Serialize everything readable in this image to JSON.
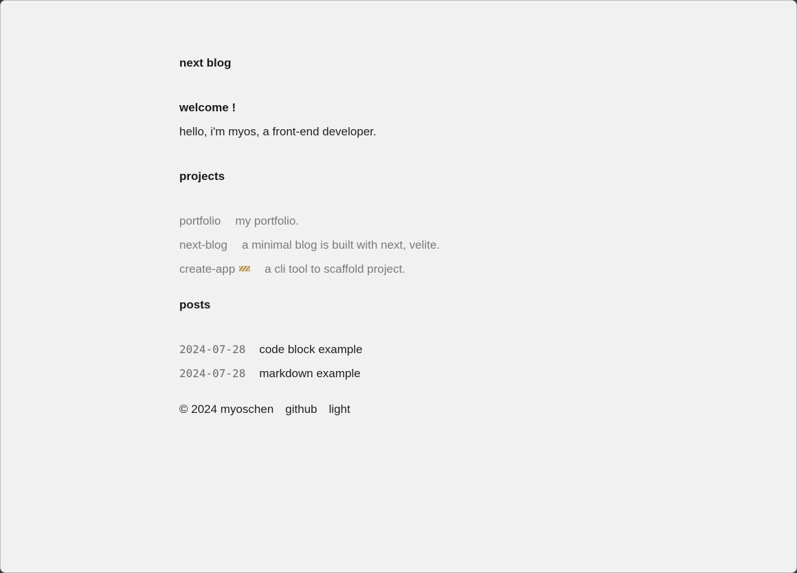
{
  "header": {
    "site_title": "next blog"
  },
  "welcome": {
    "title": "welcome !",
    "intro": "hello, i'm myos, a front-end developer."
  },
  "projects": {
    "title": "projects",
    "items": [
      {
        "name": "portfolio",
        "description": "my portfolio.",
        "wip": false
      },
      {
        "name": "next-blog",
        "description": "a minimal blog is built with next, velite.",
        "wip": false
      },
      {
        "name": "create-app",
        "description": "a cli tool to scaffold project.",
        "wip": true,
        "badge_icon": "work-in-progress-icon"
      }
    ]
  },
  "posts": {
    "title": "posts",
    "items": [
      {
        "date": "2024-07-28",
        "title": "code block example"
      },
      {
        "date": "2024-07-28",
        "title": "markdown example"
      }
    ]
  },
  "footer": {
    "copyright": "© 2024 myoschen",
    "github_label": "github",
    "theme_label": "light"
  },
  "colors": {
    "background": "#f1f1f1",
    "text": "#1a1a1a",
    "muted": "#7a7a7a",
    "wip_accent": "#b58d3c"
  }
}
